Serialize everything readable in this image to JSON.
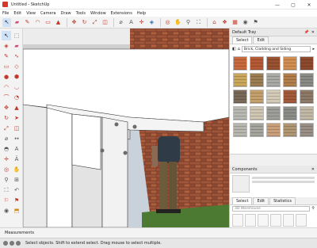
{
  "window": {
    "title": "Untitled - SketchUp",
    "minimize": "—",
    "maximize": "▢",
    "close": "✕"
  },
  "menu": [
    "File",
    "Edit",
    "View",
    "Camera",
    "Draw",
    "Tools",
    "Window",
    "Extensions",
    "Help"
  ],
  "toolbar": {
    "icons": [
      "select-icon",
      "eraser-icon",
      "pencil-icon",
      "arc-icon",
      "rectangle-icon",
      "push-pull-icon",
      "move-icon",
      "rotate-icon",
      "scale-icon",
      "offset-icon",
      "tape-icon",
      "text-icon",
      "axes-icon",
      "3d-text-icon",
      "paint-icon",
      "orbit-icon",
      "pan-icon",
      "zoom-icon",
      "zoom-extents-icon",
      "warehouse-icon",
      "extension-icon",
      "layout-icon",
      "camera-icon",
      "walk-icon"
    ]
  },
  "tray": {
    "title": "Default Tray",
    "materials": {
      "tabs": [
        "Select",
        "Edit"
      ],
      "selected_collection": "Brick, Cladding and Siding",
      "swatch_colors": [
        "#c86a3c",
        "#b55a34",
        "#9a5132",
        "#d28e52",
        "#8f4a2e",
        "#c9a85b",
        "#9c7e52",
        "#a9a9a6",
        "#b27e4c",
        "#8a8a86",
        "#7a6a5a",
        "#c4a06c",
        "#d4cab8",
        "#a35a3a",
        "#8e7a68",
        "#b9b9b3",
        "#cfc6b3",
        "#9e9e9a",
        "#8c8c88",
        "#c1b9a5",
        "#b7b7b0",
        "#a5a59e",
        "#c9a07a",
        "#b09673",
        "#9a8f86"
      ]
    },
    "components": {
      "title": "Components",
      "tabs": [
        "Select",
        "Edit",
        "Statistics"
      ],
      "search_placeholder": "3D Warehouse"
    }
  },
  "measurements": {
    "label": "Measurements"
  },
  "status": {
    "text": "Select objects. Shift to extend select. Drag mouse to select multiple."
  }
}
